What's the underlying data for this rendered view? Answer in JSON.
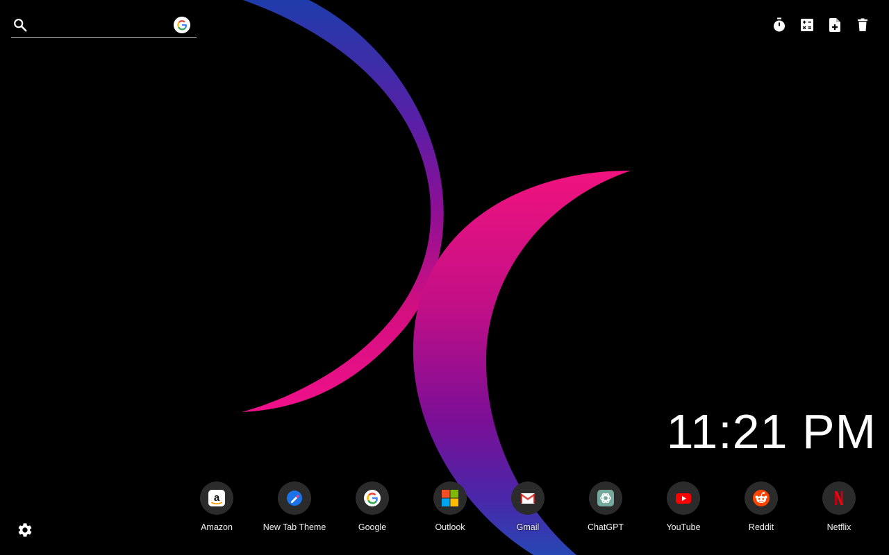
{
  "search": {
    "value": "",
    "placeholder": "",
    "icon": "search-icon",
    "engine_icon": "google-icon"
  },
  "toolbar": [
    {
      "icon": "timer-icon"
    },
    {
      "icon": "calculator-icon"
    },
    {
      "icon": "new-note-icon"
    },
    {
      "icon": "trash-icon"
    }
  ],
  "clock": {
    "time": "11:21 PM"
  },
  "shortcuts": [
    {
      "label": "Amazon",
      "icon": "amazon-icon"
    },
    {
      "label": "New Tab Theme",
      "icon": "new-tab-theme-icon"
    },
    {
      "label": "Google",
      "icon": "google-icon"
    },
    {
      "label": "Outlook",
      "icon": "microsoft-icon"
    },
    {
      "label": "Gmail",
      "icon": "gmail-icon"
    },
    {
      "label": "ChatGPT",
      "icon": "chatgpt-icon"
    },
    {
      "label": "YouTube",
      "icon": "youtube-icon"
    },
    {
      "label": "Reddit",
      "icon": "reddit-icon"
    },
    {
      "label": "Netflix",
      "icon": "netflix-icon"
    }
  ],
  "settings": {
    "icon": "gear-icon"
  },
  "colors": {
    "background": "#000000",
    "gradient_blue": "#1e3aa8",
    "gradient_purple": "#7b139f",
    "gradient_pink": "#e0107a",
    "shortcut_circle": "#2b2b2b"
  }
}
